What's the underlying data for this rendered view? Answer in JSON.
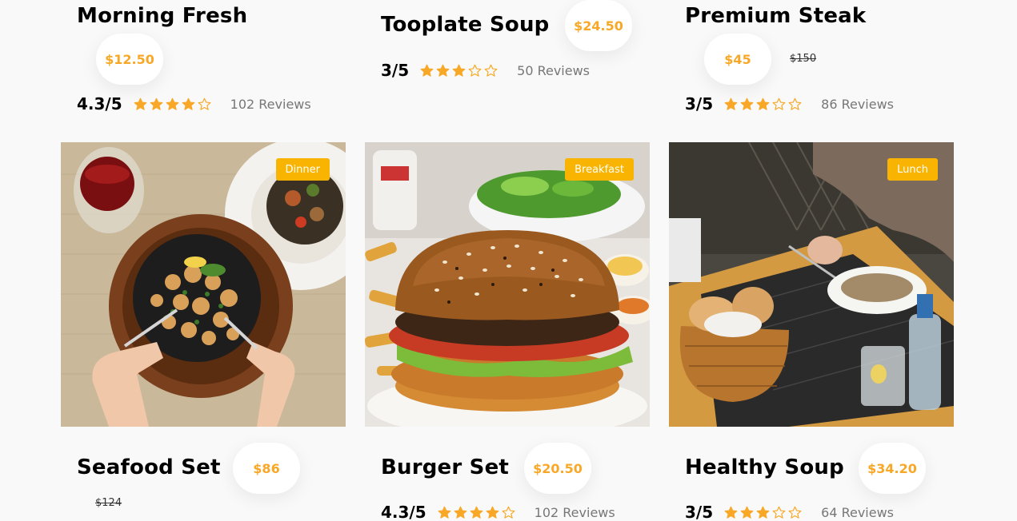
{
  "colors": {
    "accent": "#f8a826",
    "tag": "#f8b400",
    "background": "#f9f9f9"
  },
  "top_cards": [
    {
      "title": "Morning Fresh",
      "price": "$12.50",
      "old_price": "",
      "score": "4.3/5",
      "stars": 4,
      "reviews": "102 Reviews"
    },
    {
      "title": "Tooplate Soup",
      "price": "$24.50",
      "old_price": "",
      "score": "3/5",
      "stars": 3,
      "reviews": "50 Reviews"
    },
    {
      "title": "Premium Steak",
      "price": "$45",
      "old_price": "$150",
      "score": "3/5",
      "stars": 3,
      "reviews": "86 Reviews"
    }
  ],
  "bottom_cards": [
    {
      "tag": "Dinner",
      "image": "seafood-photo",
      "title": "Seafood Set",
      "price": "$86",
      "old_price": "$124",
      "score": "",
      "stars": 0,
      "reviews": ""
    },
    {
      "tag": "Breakfast",
      "image": "burger-photo",
      "title": "Burger Set",
      "price": "$20.50",
      "old_price": "",
      "score": "4.3/5",
      "stars": 4,
      "reviews": "102 Reviews"
    },
    {
      "tag": "Lunch",
      "image": "soup-photo",
      "title": "Healthy Soup",
      "price": "$34.20",
      "old_price": "",
      "score": "3/5",
      "stars": 3,
      "reviews": "64 Reviews"
    }
  ]
}
